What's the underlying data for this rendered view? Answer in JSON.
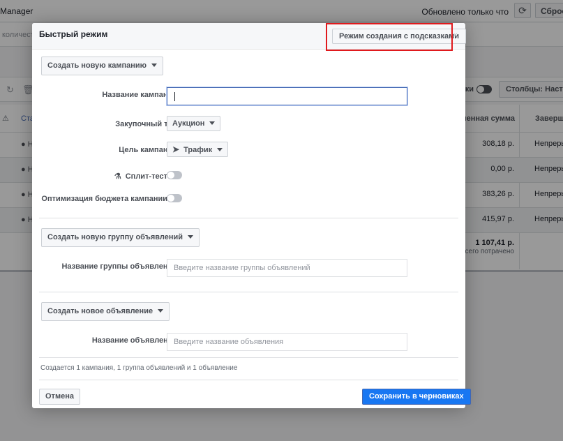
{
  "background": {
    "app_name": "Manager",
    "updated_text": "Обновлено только что",
    "reset_label": "Сброс",
    "quantity_text": "количест",
    "columns_label": "Столбцы: Настрой",
    "toggle_label": "йки",
    "table": {
      "status_header": "Ста",
      "spent_header": "раченная сумма",
      "end_header": "Заверше",
      "rows": [
        {
          "status": "Н",
          "spent": "308,18 р.",
          "end": "Непреры"
        },
        {
          "status": "Н",
          "spent": "0,00 р.",
          "end": "Непреры"
        },
        {
          "status": "Н",
          "spent": "383,26 р.",
          "end": "Непреры"
        },
        {
          "status": "Н",
          "spent": "415,97 р.",
          "end": "Непреры"
        }
      ],
      "total_value": "1 107,41 р.",
      "total_label": "Всего потрачено"
    }
  },
  "modal": {
    "title": "Быстрый режим",
    "guided_mode_label": "Режим создания с подсказками",
    "close_icon": "×",
    "campaign": {
      "create_button": "Создать новую кампанию",
      "name_label": "Название кампании",
      "name_value": "",
      "buying_type_label": "Закупочный тип",
      "buying_type_value": "Аукцион",
      "objective_label": "Цель кампании",
      "objective_value": "Трафик",
      "split_test_label": "Сплит-тест",
      "split_test_on": false,
      "budget_opt_label": "Оптимизация бюджета кампании",
      "budget_opt_on": false
    },
    "adset": {
      "create_button": "Создать новую группу объявлений",
      "name_label": "Название группы объявлений",
      "name_placeholder": "Введите название группы объявлений"
    },
    "ad": {
      "create_button": "Создать новое объявление",
      "name_label": "Название объявления",
      "name_placeholder": "Введите название объявления"
    },
    "summary": "Создается 1 кампания, 1 группа объявлений и 1 объявление",
    "cancel_label": "Отмена",
    "save_label": "Сохранить в черновиках"
  },
  "colors": {
    "highlight": "#e0191d",
    "primary": "#1877f2"
  }
}
